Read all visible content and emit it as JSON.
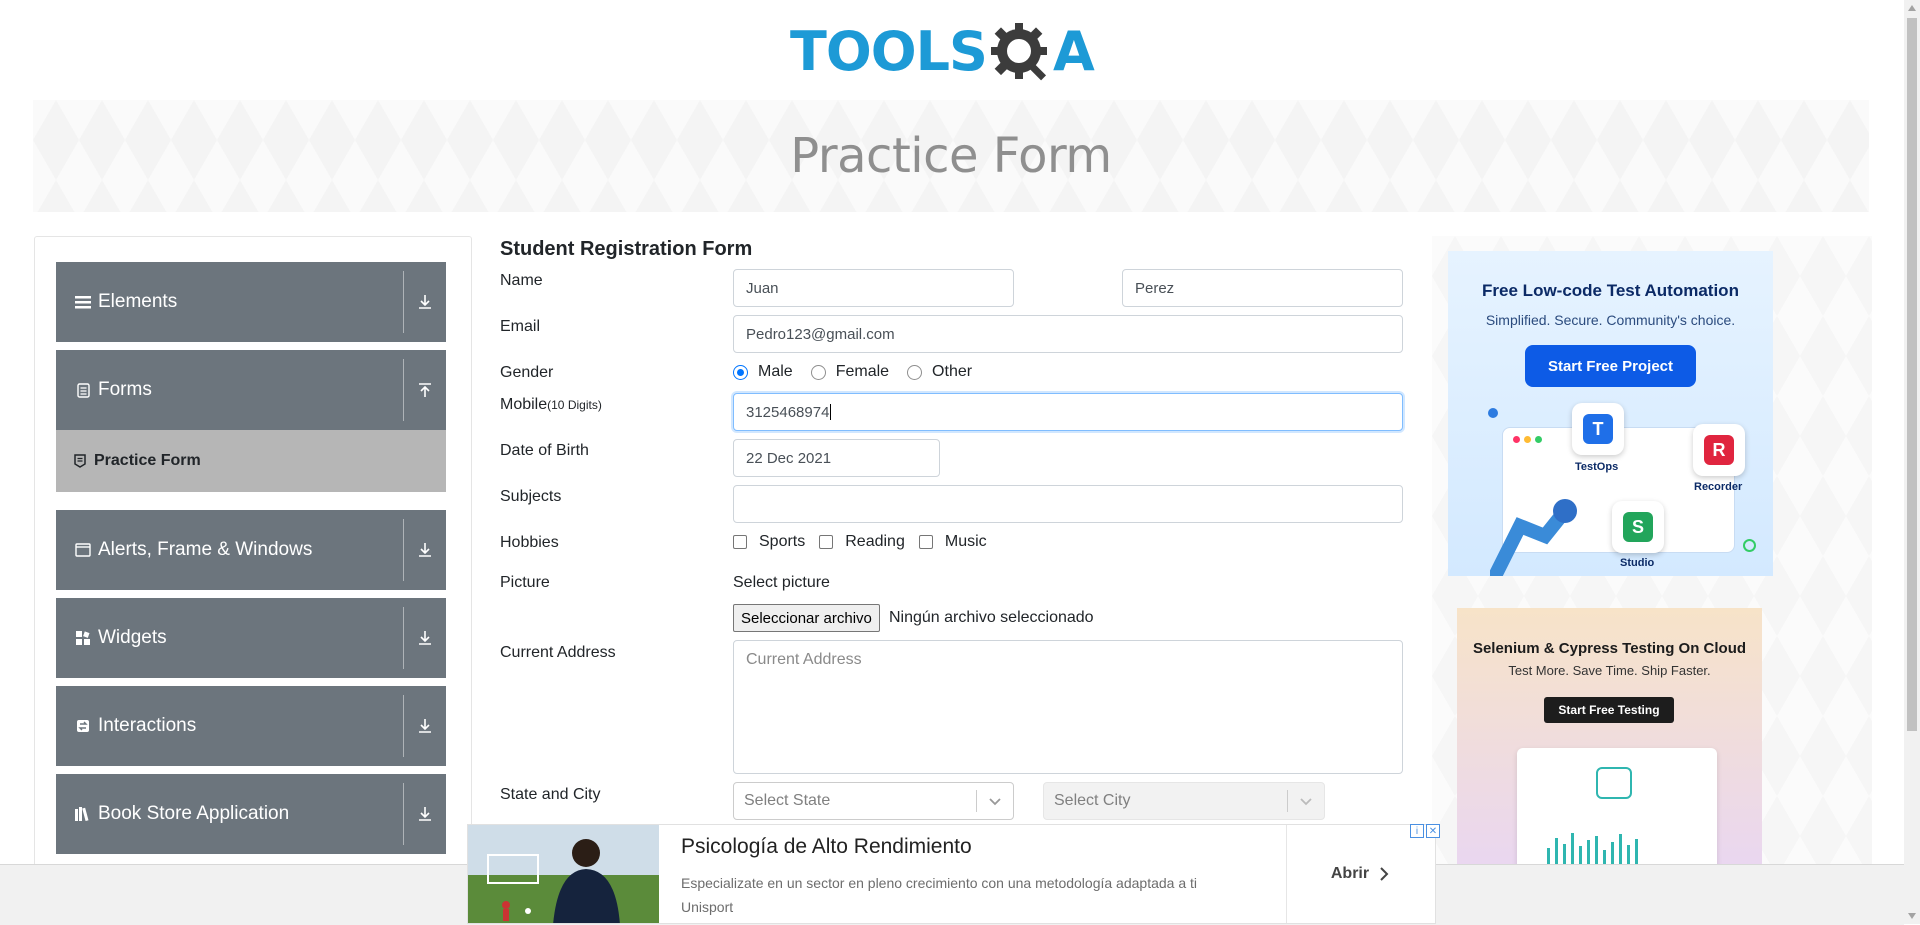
{
  "logo": {
    "part1": "TOOLS",
    "part2": "A"
  },
  "banner": {
    "title": "Practice Form"
  },
  "sidebar": {
    "groups": [
      {
        "label": "Elements",
        "icon": "hamburger-icon"
      },
      {
        "label": "Forms",
        "icon": "document-icon",
        "expanded": true,
        "items": [
          {
            "label": "Practice Form"
          }
        ]
      },
      {
        "label": "Alerts, Frame & Windows",
        "icon": "window-icon"
      },
      {
        "label": "Widgets",
        "icon": "widgets-icon"
      },
      {
        "label": "Interactions",
        "icon": "interactions-icon"
      },
      {
        "label": "Book Store Application",
        "icon": "books-icon"
      }
    ]
  },
  "form": {
    "title": "Student Registration Form",
    "name": {
      "label": "Name",
      "first": "Juan",
      "last": "Perez"
    },
    "email": {
      "label": "Email",
      "value": "Pedro123@gmail.com"
    },
    "gender": {
      "label": "Gender",
      "options": [
        "Male",
        "Female",
        "Other"
      ],
      "selected": "Male"
    },
    "mobile": {
      "label": "Mobile",
      "hint": "(10 Digits)",
      "value": "3125468974"
    },
    "dob": {
      "label": "Date of Birth",
      "value": "22 Dec 2021"
    },
    "subjects": {
      "label": "Subjects",
      "value": ""
    },
    "hobbies": {
      "label": "Hobbies",
      "options": [
        "Sports",
        "Reading",
        "Music"
      ]
    },
    "picture": {
      "label": "Picture",
      "select_label": "Select picture",
      "button": "Seleccionar archivo",
      "status": "Ningún archivo seleccionado"
    },
    "address": {
      "label": "Current Address",
      "placeholder": "Current Address"
    },
    "state_city": {
      "label": "State and City",
      "state_placeholder": "Select State",
      "city_placeholder": "Select City"
    }
  },
  "ads": {
    "ad1": {
      "title": "Free Low-code Test Automation",
      "subtitle": "Simplified. Secure. Community's choice.",
      "cta": "Start Free Project",
      "apps": [
        "TestOps",
        "Recorder",
        "Studio"
      ]
    },
    "ad2": {
      "title": "Selenium & Cypress Testing On Cloud",
      "subtitle": "Test More. Save Time. Ship Faster.",
      "cta": "Start Free Testing"
    },
    "bottom": {
      "title": "Psicología de Alto Rendimiento",
      "description": "Especializate en un sector en pleno crecimiento con una metodología adaptada a ti",
      "advertiser": "Unisport",
      "cta": "Abrir"
    }
  },
  "colors": {
    "brand_blue": "#1d9ad6",
    "sidebar_gray": "#6c757d",
    "active_item": "#b6b6b6",
    "primary": "#0d5be6"
  }
}
